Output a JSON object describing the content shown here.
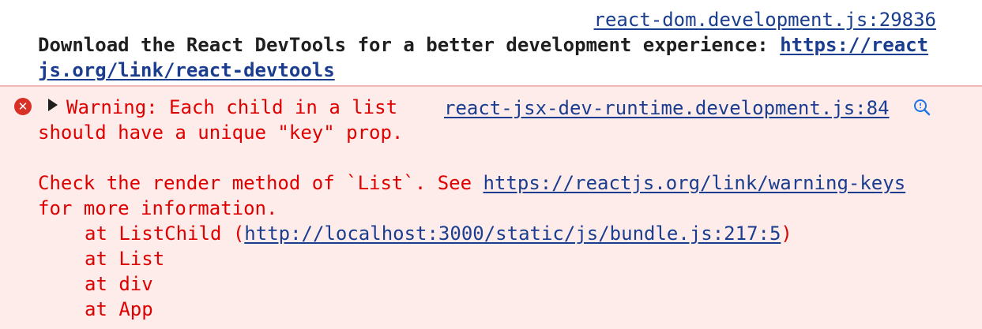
{
  "info_message": {
    "source_link": "react-dom.development.js:29836",
    "text": "Download the React DevTools for a better development experience: ",
    "link_line1": "https://react",
    "link_line2": "js.org/link/react-devtools"
  },
  "error_message": {
    "icon": "error-x-icon",
    "expand_icon": "expand-triangle-icon",
    "head_line1": "Warning: Each child in a list",
    "head_line2": "should have a unique \"key\" prop.",
    "source_link": "react-jsx-dev-runtime.development.js:84",
    "search_icon": "search-icon",
    "body_prefix": "Check the render method of `List`. See ",
    "body_link": "https://reactjs.org/link/warning-keys",
    "body_line2": "for more information.",
    "stack": [
      {
        "prefix": "at ListChild (",
        "link": "http://localhost:3000/static/js/bundle.js:217:5",
        "suffix": ")"
      },
      {
        "prefix": "at List"
      },
      {
        "prefix": "at div"
      },
      {
        "prefix": "at App"
      }
    ]
  },
  "colors": {
    "error_background": "#fdecea",
    "error_text": "#e00000",
    "link": "#1a3d8f",
    "divider": "#f2b8b5"
  }
}
